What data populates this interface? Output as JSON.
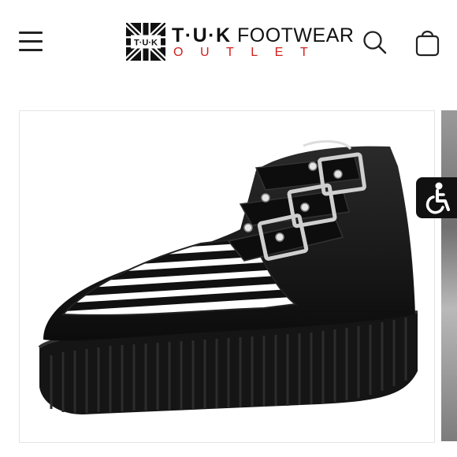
{
  "header": {
    "menu_icon": "hamburger-menu-icon",
    "logo": {
      "mark_text": "T·U·K",
      "brand": "T·U·K",
      "brand_suffix": "FOOTWEAR",
      "subline": "OUTLET",
      "subline_color": "#d0211c"
    },
    "search_icon": "search-icon",
    "cart_icon": "shopping-bag-icon"
  },
  "product": {
    "image_subject": "black leather pointed creeper boot with three buckle straps and black-and-white striped toe",
    "colors": {
      "leather": "#111111",
      "stripe_light": "#ffffff",
      "buckle": "#c9c9c9"
    }
  },
  "accessibility": {
    "icon": "accessibility-wheelchair-icon"
  },
  "colors": {
    "background": "#ffffff",
    "text": "#111111",
    "accent": "#d0211c",
    "border": "#e4e4e4"
  }
}
